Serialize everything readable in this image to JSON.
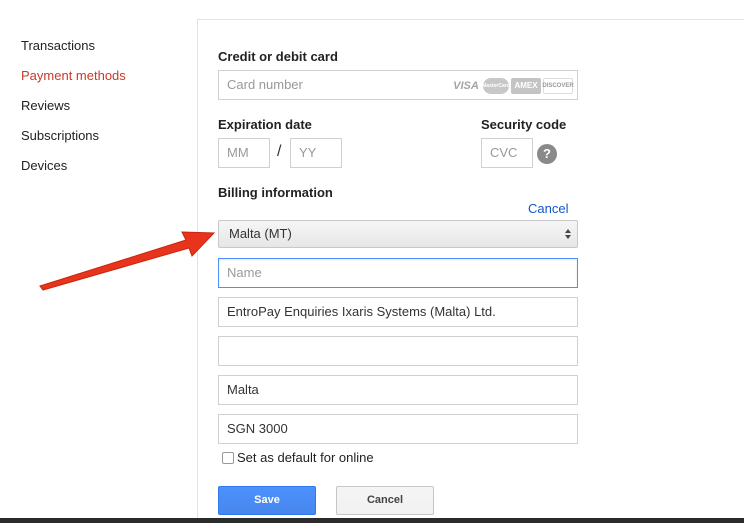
{
  "sidebar": {
    "items": [
      {
        "label": "Transactions",
        "active": false
      },
      {
        "label": "Payment methods",
        "active": true
      },
      {
        "label": "Reviews",
        "active": false
      },
      {
        "label": "Subscriptions",
        "active": false
      },
      {
        "label": "Devices",
        "active": false
      }
    ]
  },
  "card": {
    "heading": "Credit or debit card",
    "number_placeholder": "Card number",
    "logos": [
      "VISA",
      "MasterCard",
      "AMEX",
      "DISCOVER"
    ]
  },
  "expiration": {
    "heading": "Expiration date",
    "month_placeholder": "MM",
    "separator": "/",
    "year_placeholder": "YY"
  },
  "security": {
    "heading": "Security code",
    "cvc_placeholder": "CVC",
    "help_glyph": "?"
  },
  "billing": {
    "heading": "Billing information",
    "cancel_link": "Cancel",
    "country_selected": "Malta (MT)",
    "name_placeholder": "Name",
    "address_line1": "EntroPay Enquiries Ixaris Systems (Malta) Ltd.",
    "address_line2": "",
    "city": "Malta",
    "postal_code": "SGN 3000",
    "default_checkbox_label": "Set as default for online",
    "default_checked": false
  },
  "actions": {
    "save_label": "Save",
    "cancel_label": "Cancel"
  },
  "colors": {
    "active_nav": "#c63b2a",
    "link": "#1155cc",
    "primary_button": "#4d90fe",
    "annotation_arrow": "#e8341c"
  }
}
